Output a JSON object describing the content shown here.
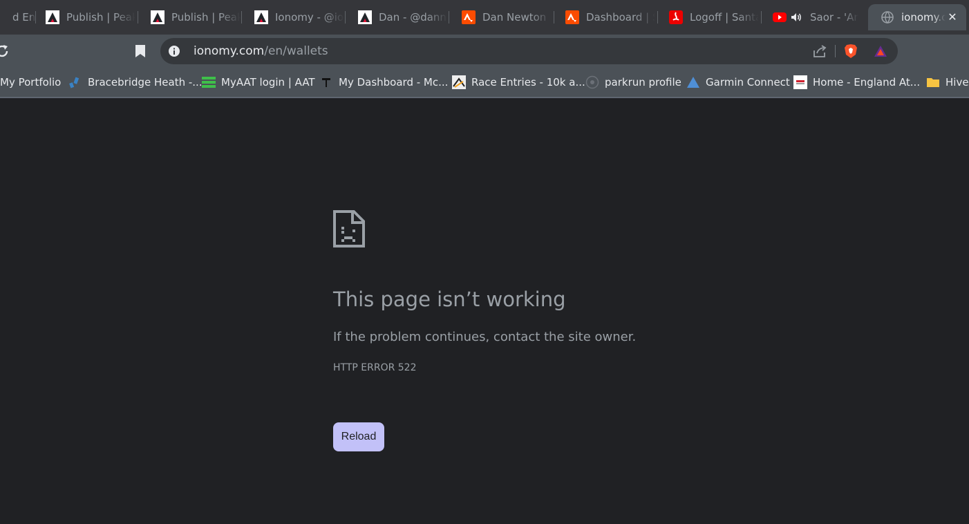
{
  "tabs": [
    {
      "title": "d End",
      "icon": "globe-icon"
    },
    {
      "title": "Publish | Peak",
      "icon": "peakd-icon"
    },
    {
      "title": "Publish | Peak",
      "icon": "peakd-icon"
    },
    {
      "title": "Ionomy - @io",
      "icon": "peakd-icon"
    },
    {
      "title": "Dan - @dann",
      "icon": "peakd-icon"
    },
    {
      "title": "Dan Newton",
      "icon": "strava-icon"
    },
    {
      "title": "Dashboard | S",
      "icon": "strava-icon"
    },
    {
      "title": "Logoff | Santa",
      "icon": "santander-icon"
    },
    {
      "title": "Saor - 'An",
      "icon": "youtube-icon",
      "audio": "speaker-icon"
    },
    {
      "title": "ionomy.c",
      "icon": "globe-icon",
      "active": true,
      "close": "✕"
    }
  ],
  "address_bar": {
    "domain": "ionomy.com",
    "path": "/en/wallets"
  },
  "bookmarks": [
    {
      "label": "My Portfolio",
      "icon": "none"
    },
    {
      "label": "Bracebridge Heath -...",
      "icon": "bracebridge-icon"
    },
    {
      "label": "MyAAT login | AAT",
      "icon": "aat-icon"
    },
    {
      "label": "My Dashboard - Mc...",
      "icon": "mcdashboard-icon"
    },
    {
      "label": "Race Entries - 10k a...",
      "icon": "race-icon"
    },
    {
      "label": "parkrun profile",
      "icon": "parkrun-icon"
    },
    {
      "label": "Garmin Connect",
      "icon": "garmin-icon"
    },
    {
      "label": "Home - England At...",
      "icon": "england-athletics-icon"
    },
    {
      "label": "Hive",
      "icon": "folder-icon"
    }
  ],
  "error": {
    "icon": "sad-page-icon",
    "title": "This page isn’t working",
    "message": "If the problem continues, contact the site owner.",
    "code": "HTTP ERROR 522",
    "reload_label": "Reload"
  },
  "colors": {
    "page_bg": "#202124",
    "tabstrip_bg": "#35363a",
    "toolbar_bg": "#4b5157",
    "omnibox_bg": "#35383c",
    "error_text": "#9aa0a6",
    "reload_bg": "#c2c1f8"
  }
}
